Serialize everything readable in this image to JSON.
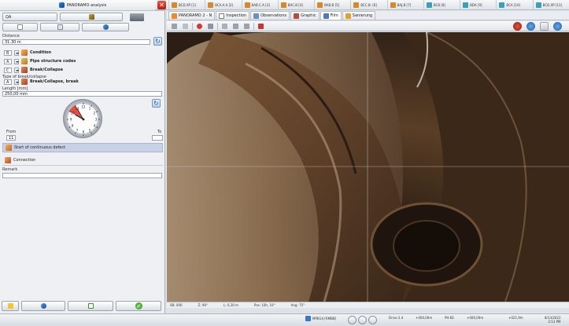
{
  "app": {
    "title": "PANORAMO analysis"
  },
  "top_strip": {
    "close_label": "✕",
    "items": [
      "BCD.XP [1]",
      "BCA.A.A [2]",
      "BAB.C.A [3]",
      "BAC.B [4]",
      "BAB.B [5]",
      "BCC.B- [6]",
      "BAJ.B [7]",
      "BCB [8]",
      "BDA [9]",
      "BCA [10]",
      "BCD.XP [11]"
    ]
  },
  "left": {
    "toolbar": {
      "qa_label": "QA"
    },
    "distance": {
      "label": "Distance",
      "value": "31.30 m"
    },
    "codes": [
      {
        "code": "B",
        "label": "Condition",
        "icon_color": "#e07a2a"
      },
      {
        "code": "A",
        "label": "Pipe structure codes",
        "icon_color": "#d99027"
      },
      {
        "code": "C",
        "label": "Break/Collapse",
        "icon_color": "#c75f2b"
      }
    ],
    "type_label": "Type of break/collapse",
    "type_code": "A",
    "type_value": "Break/Collapse, break",
    "length": {
      "label": "Length [mm]",
      "value": "250,00 mm"
    },
    "clock": {
      "hours": [
        "12",
        "1",
        "2",
        "3",
        "4",
        "5",
        "6",
        "7",
        "8",
        "9",
        "10",
        "11"
      ],
      "from_hour": 10,
      "to_hour": 11
    },
    "from": {
      "label": "From",
      "value": "11"
    },
    "to": {
      "label": "To",
      "value": ""
    },
    "continuous_label": "Start of continuous defect",
    "connection_label": "Connection",
    "remark": {
      "label": "Remark",
      "value": ""
    }
  },
  "tabs": [
    "PANORAMO 2 - N",
    "Inspection",
    "Observations",
    "Graphic",
    "Film",
    "Sanierung"
  ],
  "active_tab": "Film",
  "overlay_bar": {
    "counter": "0B: 000",
    "z": "Z: 90°",
    "length": "L: 0,30 m",
    "pos": "Pos: 10h, 10°",
    "ang": "Ang: 75°"
  },
  "taskbar": {
    "mode": "MPEG4 [RMBB]",
    "drive": "Drive 2.4",
    "dist1": "+000,00m",
    "ph": "PH:KE",
    "dist2": "+000,00m",
    "dist3": "+021,9m",
    "date": "8/13/2022",
    "time": "2:13 PM"
  },
  "colors": {
    "accent": "#1f5fb0",
    "highlight": "#c9d2e4",
    "close": "#c6281b"
  }
}
